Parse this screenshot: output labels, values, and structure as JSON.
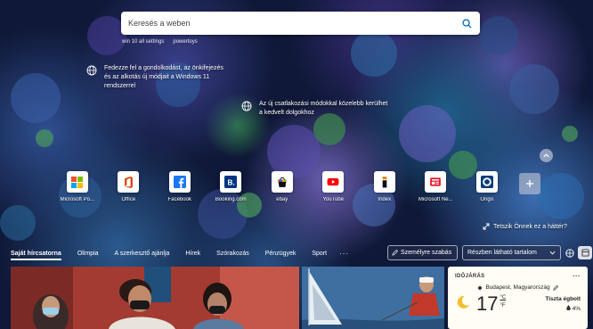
{
  "search": {
    "placeholder": "Keresés a weben"
  },
  "trending": [
    "win 10 all settings",
    "powertoys"
  ],
  "tips": [
    {
      "text": "Fedezze fel a gondolkodást, az önkifejezés és az alkotás új módjait a Windows 11 rendszerrel"
    },
    {
      "text": "Az új csatlakozási módokkal közelebb kerülhet a kedvelt dolgokhoz"
    }
  ],
  "tiles": [
    {
      "label": "Microsoft Po...",
      "icon": "microsoft-icon"
    },
    {
      "label": "Office",
      "icon": "office-icon"
    },
    {
      "label": "Facebook",
      "icon": "facebook-icon"
    },
    {
      "label": "Booking.com",
      "icon": "booking-icon"
    },
    {
      "label": "ebay",
      "icon": "ebay-icon"
    },
    {
      "label": "YouTube",
      "icon": "youtube-icon"
    },
    {
      "label": "Index",
      "icon": "index-icon"
    },
    {
      "label": "Microsoft Ne...",
      "icon": "microsoft-news-icon"
    },
    {
      "label": "Origo",
      "icon": "origo-icon"
    }
  ],
  "background_question": "Tetszik Önnek ez a háttér?",
  "nav": {
    "tabs": [
      "Saját hírcsatorna",
      "Olimpia",
      "A szerkesztő ajánlja",
      "Hírek",
      "Szórakozás",
      "Pénzügyek",
      "Sport"
    ],
    "more": "···",
    "personalize": "Személyre szabás",
    "visible_content": "Részben látható tartalom"
  },
  "weather": {
    "title": "IDŐJÁRÁS",
    "more": "···",
    "location": "Budapest, Magyarország",
    "temperature": "17",
    "unit_c": "°C",
    "unit_f": "°F",
    "condition": "Tiszta égbolt",
    "precipitation": "4%"
  },
  "colors": {
    "accent": "#0067b8",
    "background_dark": "#0f1838"
  }
}
